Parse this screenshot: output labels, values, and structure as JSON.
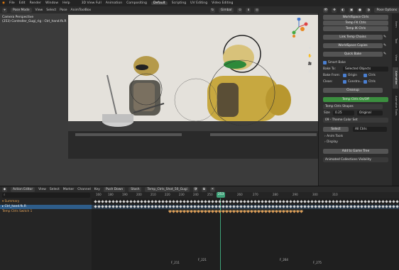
{
  "topbar": {
    "menus": [
      "File",
      "Edit",
      "Render",
      "Window",
      "Help"
    ],
    "workspaces": [
      "3D View Full",
      "Animation",
      "Compositing",
      "Default",
      "Scripting",
      "UV Editing",
      "Video Editing"
    ],
    "active_workspace": "Default"
  },
  "viewport_header": {
    "mode": "Pose Mode",
    "menus": [
      "View",
      "Select",
      "Pose",
      "AnimToolBox"
    ],
    "orientation": "Gimbal",
    "pose_options": "Pose Options"
  },
  "viewport": {
    "camera_label": "Camera Perspective",
    "object_label": "(253) Controller_Gugi_rig : Ctrl_hand.fk.R"
  },
  "npanel": {
    "tabs": [
      "Item",
      "Tool",
      "View",
      "Animation",
      "Animator Tools"
    ],
    "buttons": [
      "WorldSpace Ctrls",
      "Temp FK Ctrls",
      "Temp IK Ctrls",
      "Link Temp Chains",
      "WorldSpace Copies",
      "Quick Bake"
    ],
    "smart_bake_label": "Smart Bake",
    "bake_to_label": "Bake To:",
    "bake_to_value": "Selected Objects",
    "bake_from_label": "Bake From:",
    "origin_label": "Origin",
    "ctrls_label": "Ctrls",
    "clean_label": "Clean:",
    "constraints_label": "Constra...",
    "cleanup_button": "Cleanup",
    "temp_ctrls_onoff": "Temp Ctrls On/Off",
    "temp_ctrls_shapes": "Temp Ctrls Shapes",
    "size_label": "Size",
    "size_value": "0.25",
    "shape_value": "Original",
    "theme_color": "09 - Theme Color Set",
    "select_button": "Select",
    "all_ctrls": "All Ctrls",
    "anim_tools": "Anim Tools",
    "display": "Display",
    "add_to_game_tree": "Add to Game Tree",
    "animated_collections": "Animated Collections Visibility"
  },
  "timeline_header": {
    "editor": "Action Editor",
    "menus": [
      "View",
      "Select",
      "Marker",
      "Channel",
      "Key"
    ],
    "push_down": "Push Down",
    "stash": "Stash",
    "action_name": "Temp_Ctrls_Shot_50_Gugi"
  },
  "timeline": {
    "current_frame": "253",
    "frame_ticks": [
      "160",
      "180",
      "190",
      "200",
      "210",
      "220",
      "230",
      "240",
      "250",
      "260",
      "270",
      "280",
      "290",
      "300",
      "310"
    ],
    "channels": [
      "Summary",
      "Ctrl_hand.fk.R",
      "Temp Ctrls Switch 1"
    ],
    "markers": [
      "F_211",
      "F_221",
      "F_264",
      "F_275"
    ]
  },
  "colors": {
    "accent_blue": "#4a7fd1",
    "frame_green": "#3fa37a",
    "channel_highlight": "#2e5d8a",
    "key_orange": "#e5a35a",
    "temp_ctrls_green": "#3b8f3f"
  }
}
